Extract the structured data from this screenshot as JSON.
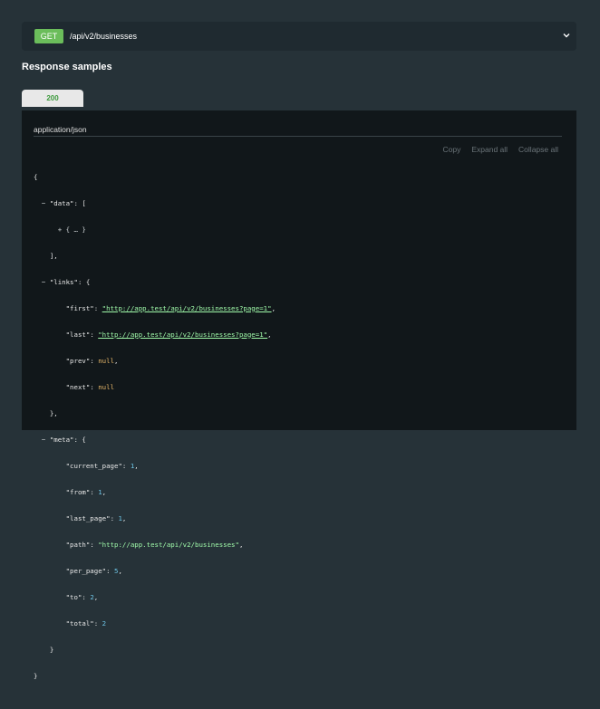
{
  "endpoint": {
    "method": "GET",
    "path": "/api/v2/businesses"
  },
  "section_title": "Response samples",
  "status_tab": "200",
  "panel": {
    "content_type": "application/json",
    "toolbar": {
      "copy": "Copy",
      "expand_all": "Expand all",
      "collapse_all": "Collapse all"
    }
  },
  "json_sample": {
    "data_collapsed": "+ { … }",
    "links": {
      "first": "\"http://app.test/api/v2/businesses?page=1\"",
      "last": "\"http://app.test/api/v2/businesses?page=1\"",
      "prev": "null",
      "next": "null"
    },
    "meta": {
      "current_page": "1",
      "from": "1",
      "last_page": "1",
      "path": "\"http://app.test/api/v2/businesses\"",
      "per_page": "5",
      "to": "2",
      "total": "2"
    }
  },
  "colors": {
    "method_get": "#6bbd5b",
    "string": "#a0fbaa",
    "number": "#6ec5e6",
    "null": "#e8b86a"
  }
}
